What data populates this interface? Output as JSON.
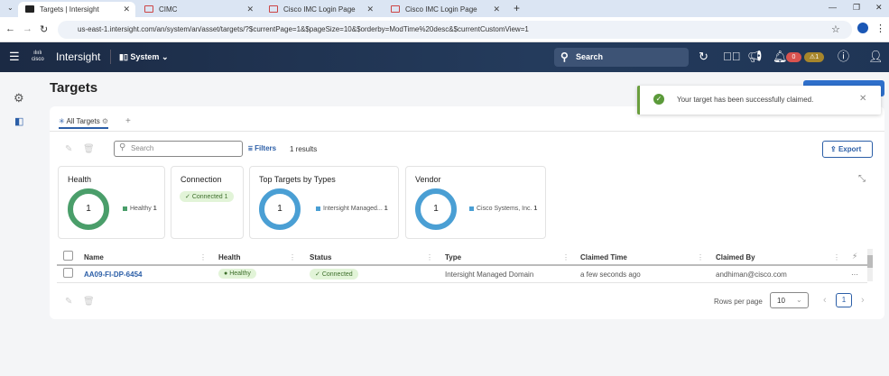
{
  "browser": {
    "tabs": [
      {
        "label": "Targets | Intersight"
      },
      {
        "label": "CIMC"
      },
      {
        "label": "Cisco IMC Login Page"
      },
      {
        "label": "Cisco IMC Login Page"
      }
    ],
    "url": "us-east-1.intersight.com/an/system/an/asset/targets/?$currentPage=1&$pageSize=10&$orderby=ModTime%20desc&$currentCustomView=1"
  },
  "header": {
    "brand": "Intersight",
    "cisco": "cisco",
    "context": "System",
    "search_placeholder": "Search",
    "alarm_critical": "0",
    "alarm_warning": "1"
  },
  "page": {
    "title": "Targets",
    "view_tab": "All Targets",
    "search_placeholder": "Search",
    "filters": "Filters",
    "results": "1 results",
    "export": "Export"
  },
  "toast": {
    "message": "Your target has been successfully claimed."
  },
  "widgets": {
    "health": {
      "title": "Health",
      "count": "1",
      "legend": "Healthy",
      "legend_count": "1"
    },
    "connection": {
      "title": "Connection",
      "pill": "Connected 1"
    },
    "types": {
      "title": "Top Targets by Types",
      "count": "1",
      "legend": "Intersight Managed...",
      "legend_count": "1"
    },
    "vendor": {
      "title": "Vendor",
      "count": "1",
      "legend": "Cisco Systems, Inc.",
      "legend_count": "1"
    }
  },
  "table": {
    "columns": [
      "Name",
      "Health",
      "Status",
      "Type",
      "Claimed Time",
      "Claimed By"
    ],
    "rows": [
      {
        "name": "AA09-FI-DP-6454",
        "health": "Healthy",
        "status": "Connected",
        "type": "Intersight Managed Domain",
        "claimed_time": "a few seconds ago",
        "claimed_by": "andhiman@cisco.com"
      }
    ]
  },
  "pagination": {
    "rows_per_page_label": "Rows per page",
    "rows_per_page": "10",
    "current_page": "1"
  },
  "colors": {
    "header": "#1b2a44",
    "healthy": "#4a9e6a",
    "type": "#4a9fd4",
    "link": "#2b5ea7"
  }
}
